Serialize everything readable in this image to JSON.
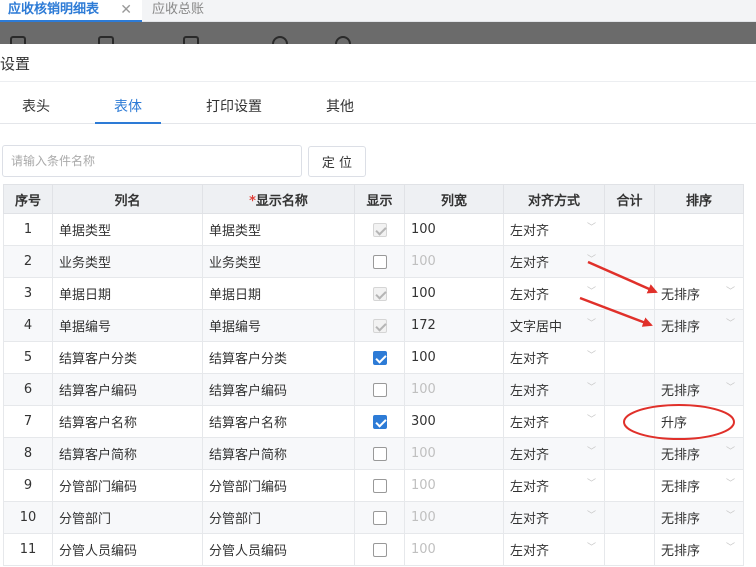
{
  "app_tabs": [
    {
      "label": "应收核销明细表",
      "active": true
    },
    {
      "label": "应收总账",
      "active": false
    }
  ],
  "dialog": {
    "title": "设置",
    "tabs": [
      "表头",
      "表体",
      "打印设置",
      "其他"
    ],
    "active_tab": "表体"
  },
  "search": {
    "placeholder": "请输入条件名称",
    "button_label": "定 位"
  },
  "table": {
    "headers": {
      "index": "序号",
      "column_name": "列名",
      "required_mark": "*",
      "display_name": "显示名称",
      "show": "显示",
      "width": "列宽",
      "align": "对齐方式",
      "total": "合计",
      "sort": "排序"
    },
    "rows": [
      {
        "index": "1",
        "column_name": "单据类型",
        "display_name": "单据类型",
        "show": "checked-disabled",
        "width": "100",
        "width_muted": false,
        "align": "左对齐",
        "sort": ""
      },
      {
        "index": "2",
        "column_name": "业务类型",
        "display_name": "业务类型",
        "show": "unchecked",
        "width": "100",
        "width_muted": true,
        "align": "左对齐",
        "sort": ""
      },
      {
        "index": "3",
        "column_name": "单据日期",
        "display_name": "单据日期",
        "show": "checked-disabled",
        "width": "100",
        "width_muted": false,
        "align": "左对齐",
        "sort": "无排序"
      },
      {
        "index": "4",
        "column_name": "单据编号",
        "display_name": "单据编号",
        "show": "checked-disabled",
        "width": "172",
        "width_muted": false,
        "align": "文字居中",
        "sort": "无排序"
      },
      {
        "index": "5",
        "column_name": "结算客户分类",
        "display_name": "结算客户分类",
        "show": "checked",
        "width": "100",
        "width_muted": false,
        "align": "左对齐",
        "sort": ""
      },
      {
        "index": "6",
        "column_name": "结算客户编码",
        "display_name": "结算客户编码",
        "show": "unchecked",
        "width": "100",
        "width_muted": true,
        "align": "左对齐",
        "sort": "无排序"
      },
      {
        "index": "7",
        "column_name": "结算客户名称",
        "display_name": "结算客户名称",
        "show": "checked",
        "width": "300",
        "width_muted": false,
        "align": "左对齐",
        "sort": "升序"
      },
      {
        "index": "8",
        "column_name": "结算客户简称",
        "display_name": "结算客户简称",
        "show": "unchecked",
        "width": "100",
        "width_muted": true,
        "align": "左对齐",
        "sort": "无排序"
      },
      {
        "index": "9",
        "column_name": "分管部门编码",
        "display_name": "分管部门编码",
        "show": "unchecked",
        "width": "100",
        "width_muted": true,
        "align": "左对齐",
        "sort": "无排序"
      },
      {
        "index": "10",
        "column_name": "分管部门",
        "display_name": "分管部门",
        "show": "unchecked",
        "width": "100",
        "width_muted": true,
        "align": "左对齐",
        "sort": "无排序"
      },
      {
        "index": "11",
        "column_name": "分管人员编码",
        "display_name": "分管人员编码",
        "show": "unchecked",
        "width": "100",
        "width_muted": true,
        "align": "左对齐",
        "sort": "无排序"
      }
    ]
  },
  "colors": {
    "accent": "#2d7bd6",
    "annotation": "#e0302a",
    "required": "#e0413a"
  }
}
